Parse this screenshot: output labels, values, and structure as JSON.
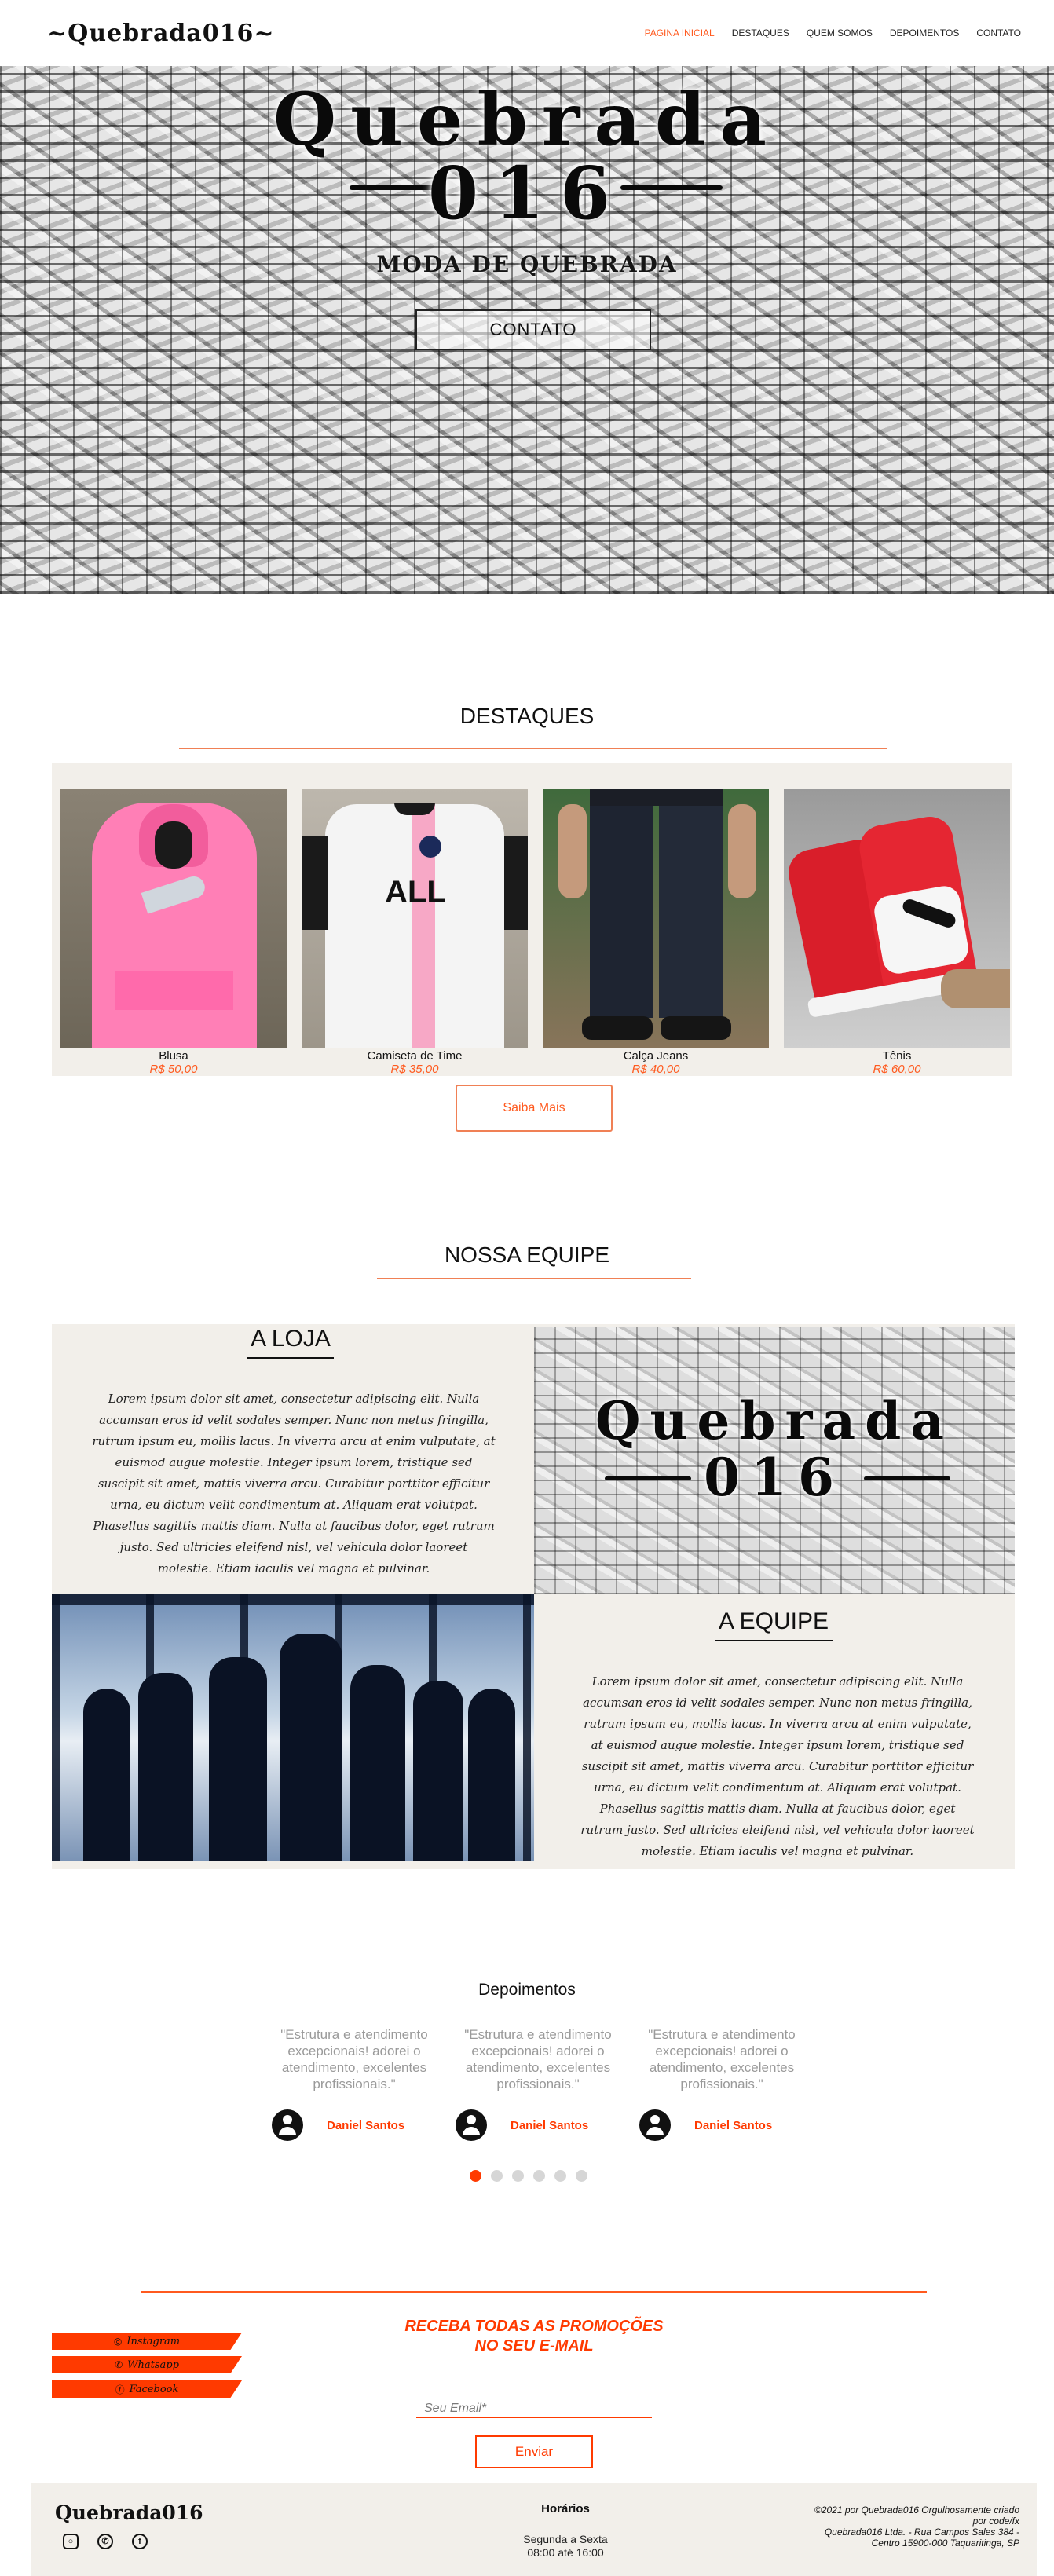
{
  "nav": {
    "brand": "~Quebrada016~",
    "items": [
      "PAGINA INICIAL",
      "DESTAQUES",
      "QUEM SOMOS",
      "DEPOIMENTOS",
      "CONTATO"
    ],
    "active_index": 0
  },
  "hero": {
    "title_line1": "Quebrada",
    "title_line2": "016",
    "subtitle": "MODA DE QUEBRADA",
    "button": "CONTATO"
  },
  "destaques": {
    "title": "DESTAQUES",
    "products": [
      {
        "name": "Blusa",
        "price": "R$ 50,00"
      },
      {
        "name": "Camiseta de Time",
        "price": "R$ 35,00"
      },
      {
        "name": "Calça Jeans",
        "price": "R$ 40,00"
      },
      {
        "name": "Tênis",
        "price": "R$ 60,00"
      }
    ],
    "button": "Saiba Mais"
  },
  "equipe": {
    "title": "NOSSA EQUIPE",
    "loja_title": "A LOJA",
    "equipe_title": "A EQUIPE",
    "logo_line1": "Quebrada",
    "logo_line2": "016",
    "lorem": "Lorem ipsum dolor sit amet, consectetur adipiscing elit. Nulla accumsan eros id velit sodales semper. Nunc non metus fringilla, rutrum ipsum eu, mollis lacus. In viverra arcu at enim vulputate, at euismod augue molestie. Integer ipsum lorem, tristique sed suscipit sit amet, mattis viverra arcu. Curabitur porttitor efficitur urna, eu dictum velit condimentum at. Aliquam erat volutpat. Phasellus sagittis mattis diam. Nulla at faucibus dolor, eget rutrum justo. Sed ultricies eleifend nisl, vel vehicula dolor laoreet molestie. Etiam iaculis vel magna et pulvinar."
  },
  "depoimentos": {
    "title": "Depoimentos",
    "items": [
      {
        "quote": "\"Estrutura e atendimento excepcionais! adorei o atendimento, excelentes profissionais.\"",
        "author": "Daniel Santos"
      },
      {
        "quote": "\"Estrutura e atendimento excepcionais! adorei o atendimento, excelentes profissionais.\"",
        "author": "Daniel Santos"
      },
      {
        "quote": "\"Estrutura e atendimento excepcionais! adorei o atendimento, excelentes profissionais.\"",
        "author": "Daniel Santos"
      }
    ],
    "dots": 6,
    "active_dot": 0
  },
  "newsletter": {
    "heading_line1": "RECEBA TODAS AS PROMOÇÕES",
    "heading_line2": "NO SEU E-MAIL",
    "email_placeholder": "Seu Email*",
    "button": "Enviar"
  },
  "social": [
    {
      "label": "Instagram",
      "icon": "instagram-icon"
    },
    {
      "label": "Whatsapp",
      "icon": "whatsapp-icon"
    },
    {
      "label": "Facebook",
      "icon": "facebook-icon"
    }
  ],
  "footer": {
    "brand": "Quebrada016",
    "hours_title": "Horários",
    "hours_line1": "Segunda a Sexta",
    "hours_line2": "08:00 até 16:00",
    "credit_line1": "©2021 por Quebrada016 Orgulhosamente criado",
    "credit_line2": "por code/fx",
    "address_line1": "Quebrada016 Ltda. - Rua Campos Sales 384 -",
    "address_line2": "Centro 15900-000 Taquaritinga, SP"
  },
  "colors": {
    "accent": "#ff5a1f",
    "band": "#f2efea"
  }
}
